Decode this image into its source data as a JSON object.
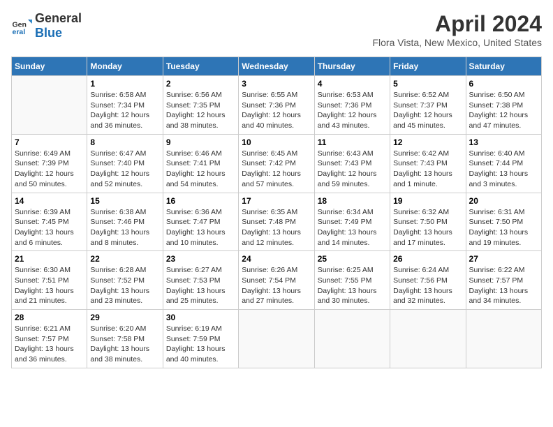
{
  "header": {
    "logo_general": "General",
    "logo_blue": "Blue",
    "month_year": "April 2024",
    "location": "Flora Vista, New Mexico, United States"
  },
  "weekdays": [
    "Sunday",
    "Monday",
    "Tuesday",
    "Wednesday",
    "Thursday",
    "Friday",
    "Saturday"
  ],
  "weeks": [
    [
      {
        "day": "",
        "content": ""
      },
      {
        "day": "1",
        "content": "Sunrise: 6:58 AM\nSunset: 7:34 PM\nDaylight: 12 hours\nand 36 minutes."
      },
      {
        "day": "2",
        "content": "Sunrise: 6:56 AM\nSunset: 7:35 PM\nDaylight: 12 hours\nand 38 minutes."
      },
      {
        "day": "3",
        "content": "Sunrise: 6:55 AM\nSunset: 7:36 PM\nDaylight: 12 hours\nand 40 minutes."
      },
      {
        "day": "4",
        "content": "Sunrise: 6:53 AM\nSunset: 7:36 PM\nDaylight: 12 hours\nand 43 minutes."
      },
      {
        "day": "5",
        "content": "Sunrise: 6:52 AM\nSunset: 7:37 PM\nDaylight: 12 hours\nand 45 minutes."
      },
      {
        "day": "6",
        "content": "Sunrise: 6:50 AM\nSunset: 7:38 PM\nDaylight: 12 hours\nand 47 minutes."
      }
    ],
    [
      {
        "day": "7",
        "content": "Sunrise: 6:49 AM\nSunset: 7:39 PM\nDaylight: 12 hours\nand 50 minutes."
      },
      {
        "day": "8",
        "content": "Sunrise: 6:47 AM\nSunset: 7:40 PM\nDaylight: 12 hours\nand 52 minutes."
      },
      {
        "day": "9",
        "content": "Sunrise: 6:46 AM\nSunset: 7:41 PM\nDaylight: 12 hours\nand 54 minutes."
      },
      {
        "day": "10",
        "content": "Sunrise: 6:45 AM\nSunset: 7:42 PM\nDaylight: 12 hours\nand 57 minutes."
      },
      {
        "day": "11",
        "content": "Sunrise: 6:43 AM\nSunset: 7:43 PM\nDaylight: 12 hours\nand 59 minutes."
      },
      {
        "day": "12",
        "content": "Sunrise: 6:42 AM\nSunset: 7:43 PM\nDaylight: 13 hours\nand 1 minute."
      },
      {
        "day": "13",
        "content": "Sunrise: 6:40 AM\nSunset: 7:44 PM\nDaylight: 13 hours\nand 3 minutes."
      }
    ],
    [
      {
        "day": "14",
        "content": "Sunrise: 6:39 AM\nSunset: 7:45 PM\nDaylight: 13 hours\nand 6 minutes."
      },
      {
        "day": "15",
        "content": "Sunrise: 6:38 AM\nSunset: 7:46 PM\nDaylight: 13 hours\nand 8 minutes."
      },
      {
        "day": "16",
        "content": "Sunrise: 6:36 AM\nSunset: 7:47 PM\nDaylight: 13 hours\nand 10 minutes."
      },
      {
        "day": "17",
        "content": "Sunrise: 6:35 AM\nSunset: 7:48 PM\nDaylight: 13 hours\nand 12 minutes."
      },
      {
        "day": "18",
        "content": "Sunrise: 6:34 AM\nSunset: 7:49 PM\nDaylight: 13 hours\nand 14 minutes."
      },
      {
        "day": "19",
        "content": "Sunrise: 6:32 AM\nSunset: 7:50 PM\nDaylight: 13 hours\nand 17 minutes."
      },
      {
        "day": "20",
        "content": "Sunrise: 6:31 AM\nSunset: 7:50 PM\nDaylight: 13 hours\nand 19 minutes."
      }
    ],
    [
      {
        "day": "21",
        "content": "Sunrise: 6:30 AM\nSunset: 7:51 PM\nDaylight: 13 hours\nand 21 minutes."
      },
      {
        "day": "22",
        "content": "Sunrise: 6:28 AM\nSunset: 7:52 PM\nDaylight: 13 hours\nand 23 minutes."
      },
      {
        "day": "23",
        "content": "Sunrise: 6:27 AM\nSunset: 7:53 PM\nDaylight: 13 hours\nand 25 minutes."
      },
      {
        "day": "24",
        "content": "Sunrise: 6:26 AM\nSunset: 7:54 PM\nDaylight: 13 hours\nand 27 minutes."
      },
      {
        "day": "25",
        "content": "Sunrise: 6:25 AM\nSunset: 7:55 PM\nDaylight: 13 hours\nand 30 minutes."
      },
      {
        "day": "26",
        "content": "Sunrise: 6:24 AM\nSunset: 7:56 PM\nDaylight: 13 hours\nand 32 minutes."
      },
      {
        "day": "27",
        "content": "Sunrise: 6:22 AM\nSunset: 7:57 PM\nDaylight: 13 hours\nand 34 minutes."
      }
    ],
    [
      {
        "day": "28",
        "content": "Sunrise: 6:21 AM\nSunset: 7:57 PM\nDaylight: 13 hours\nand 36 minutes."
      },
      {
        "day": "29",
        "content": "Sunrise: 6:20 AM\nSunset: 7:58 PM\nDaylight: 13 hours\nand 38 minutes."
      },
      {
        "day": "30",
        "content": "Sunrise: 6:19 AM\nSunset: 7:59 PM\nDaylight: 13 hours\nand 40 minutes."
      },
      {
        "day": "",
        "content": ""
      },
      {
        "day": "",
        "content": ""
      },
      {
        "day": "",
        "content": ""
      },
      {
        "day": "",
        "content": ""
      }
    ]
  ]
}
